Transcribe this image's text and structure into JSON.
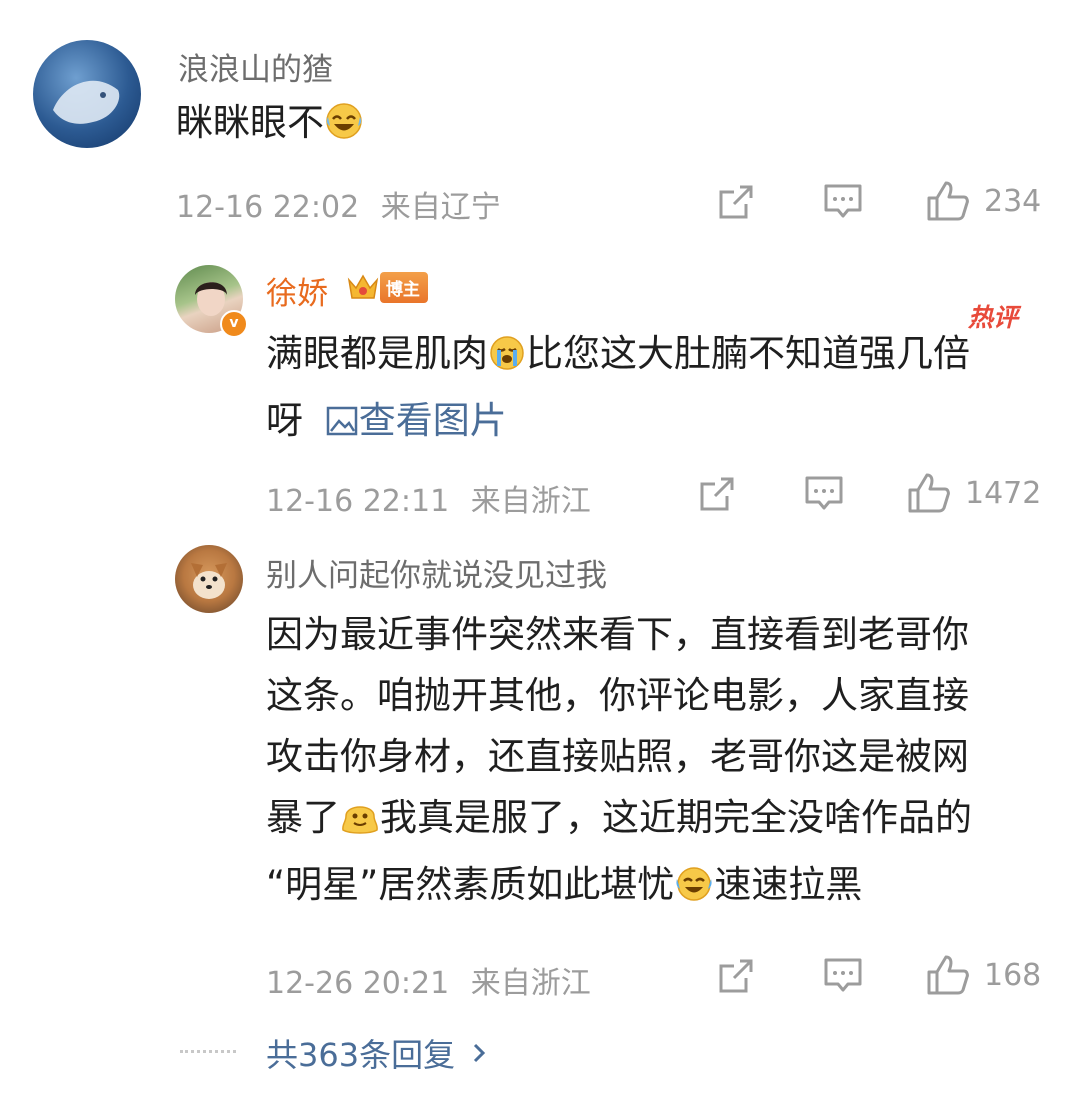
{
  "comments": [
    {
      "author": "浪浪山的猹",
      "text": "眯眯眼不",
      "emoji_after_text": "laugh-cry-emoji",
      "time": "12-16 22:02",
      "location": "来自辽宁",
      "likes": "234"
    },
    {
      "author": "徐娇",
      "badge_label": "博主",
      "hot_tag": "热评",
      "text_part1": "满眼都是肌肉",
      "emoji_mid": "crying-emoji",
      "text_part2": "比您这大肚腩不知道强几倍",
      "text_line2": "呀",
      "image_link": "查看图片",
      "time": "12-16 22:11",
      "location": "来自浙江",
      "likes": "1472"
    },
    {
      "author": "别人问起你就说没见过我",
      "line1": "因为最近事件突然来看下，直接看到老哥你",
      "line2": "这条。咱抛开其他，你评论电影，人家直接",
      "line3": "攻击你身材，还直接贴照，老哥你这是被网",
      "line4a": "暴了",
      "line4b": "我真是服了，这近期完全没啥作品的",
      "line5a": "“明星”居然素质如此堪忧",
      "line5b": "速速拉黑",
      "time": "12-26 20:21",
      "location": "来自浙江",
      "likes": "168"
    }
  ],
  "more_replies": "共363条回复",
  "colors": {
    "link": "#4a6d98",
    "name_orange": "#e86b1f",
    "meta_gray": "#9c9c9c"
  }
}
